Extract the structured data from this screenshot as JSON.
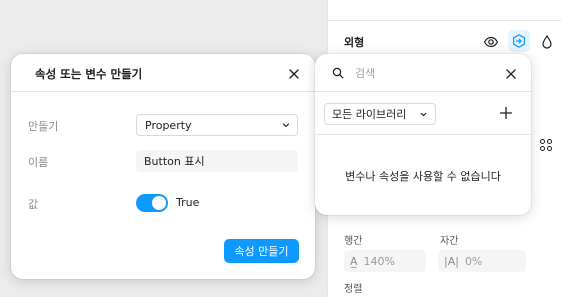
{
  "modal": {
    "title": "속성 또는 변수 만들기",
    "create_label": "만들기",
    "create_value": "Property",
    "name_label": "이름",
    "name_value": "Button 표시",
    "value_label": "값",
    "value_toggle": "True",
    "submit_label": "속성 만들기"
  },
  "popover": {
    "search_placeholder": "검색",
    "library_select": "모든 라이브러리",
    "empty_message": "변수나 속성을 사용할 수 없습니다"
  },
  "panel": {
    "section_title": "외형",
    "line_height_label": "행간",
    "line_height_value": "140%",
    "letter_spacing_label": "자간",
    "letter_spacing_value": "0%",
    "align_label": "정렬"
  },
  "colors": {
    "accent": "#0d99ff",
    "accent_light": "#e5f2ff"
  }
}
